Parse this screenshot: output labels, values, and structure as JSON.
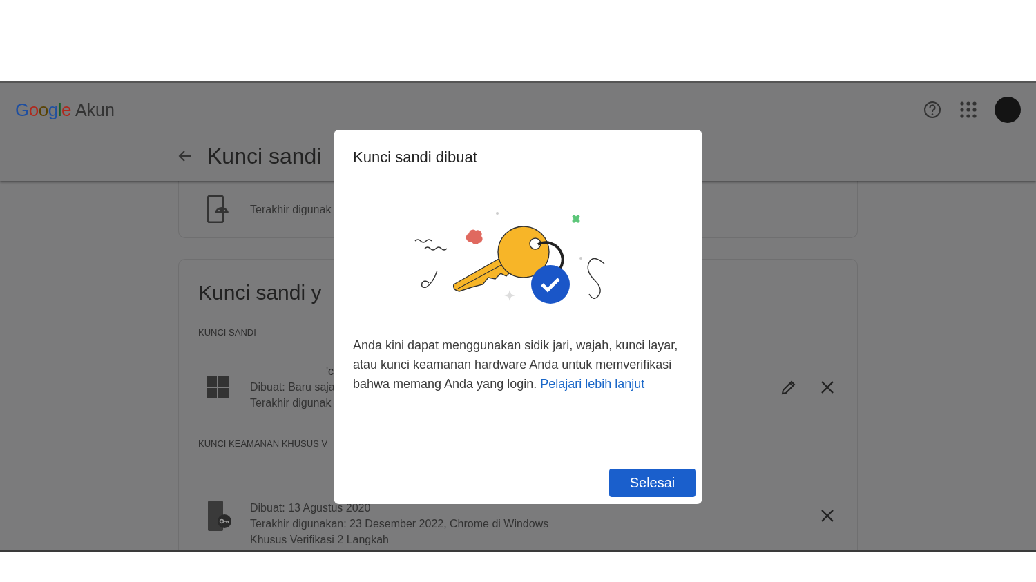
{
  "header": {
    "logo": "Google",
    "product": "Akun"
  },
  "page": {
    "title": "Kunci sandi"
  },
  "top_card": {
    "rows": [
      {
        "kind": "android_phone",
        "lines": [
          "Terakhir digunak"
        ],
        "actions": []
      }
    ]
  },
  "main_card": {
    "title": "Kunci sandi y",
    "sections": [
      {
        "heading": "KUNCI SANDI",
        "rows": [
          {
            "kind": "windows",
            "name": "'c",
            "lines": [
              "Dibuat: Baru saja",
              "Terakhir digunak"
            ],
            "actions": [
              {
                "kind": "edit"
              },
              {
                "kind": "remove"
              }
            ]
          }
        ]
      },
      {
        "heading": "KUNCI KEAMANAN KHUSUS V",
        "rows": [
          {
            "kind": "security_key_phone",
            "lines": [
              "Dibuat: 13 Agustus 2020",
              "Terakhir digunakan: 23 Desember 2022, Chrome di Windows",
              "Khusus Verifikasi 2 Langkah"
            ],
            "actions": [
              {
                "kind": "remove"
              }
            ]
          }
        ]
      }
    ]
  },
  "dialog": {
    "title": "Kunci sandi dibuat",
    "body": "Anda kini dapat menggunakan sidik jari, wajah, kunci layar, atau kunci keamanan hardware Anda untuk memverifikasi bahwa memang Anda yang login.",
    "link": "Pelajari lebih lanjut",
    "button": "Selesai"
  }
}
